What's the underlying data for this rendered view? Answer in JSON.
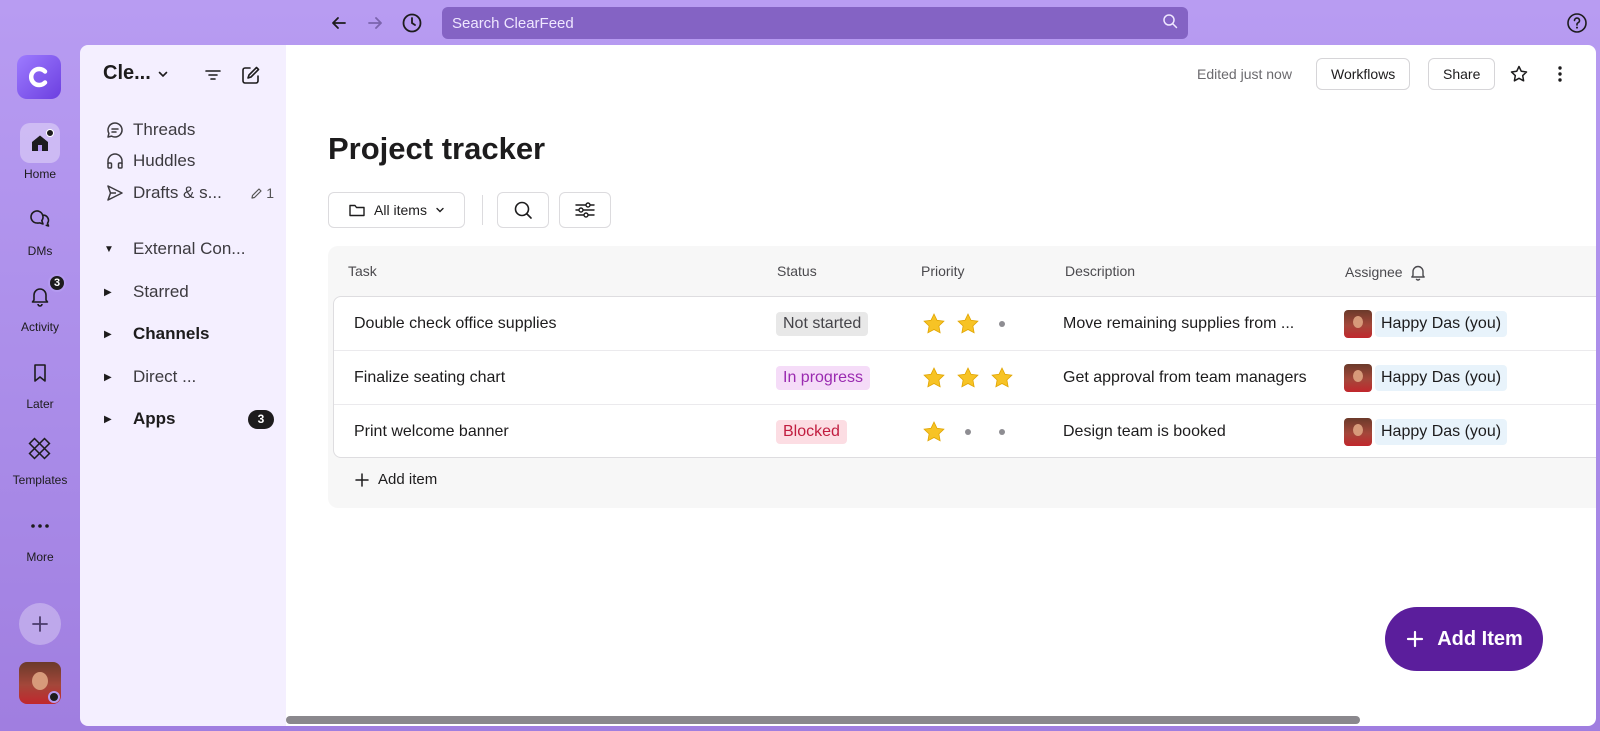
{
  "topbar": {
    "search_placeholder": "Search ClearFeed"
  },
  "rail": {
    "logo_letter": "C",
    "items": [
      {
        "label": "Home",
        "icon": "home-icon"
      },
      {
        "label": "DMs",
        "icon": "dms-icon"
      },
      {
        "label": "Activity",
        "icon": "bell-icon",
        "badge": "3"
      },
      {
        "label": "Later",
        "icon": "bookmark-icon"
      },
      {
        "label": "Templates",
        "icon": "templates-icon"
      },
      {
        "label": "More",
        "icon": "more-icon"
      }
    ]
  },
  "sidebar": {
    "workspace": "Cle...",
    "items": [
      {
        "label": "Threads",
        "icon": "threads-icon"
      },
      {
        "label": "Huddles",
        "icon": "headphones-icon"
      },
      {
        "label": "Drafts & s...",
        "icon": "send-icon",
        "count": "1"
      }
    ],
    "sections": [
      {
        "label": "External Con...",
        "expanded": true,
        "bold": false
      },
      {
        "label": "Starred",
        "expanded": false,
        "bold": false
      },
      {
        "label": "Channels",
        "expanded": false,
        "bold": true
      },
      {
        "label": "Direct ...",
        "expanded": false,
        "bold": false
      },
      {
        "label": "Apps",
        "expanded": false,
        "bold": true,
        "badge": "3"
      }
    ]
  },
  "header": {
    "edited": "Edited just now",
    "workflows_label": "Workflows",
    "share_label": "Share"
  },
  "page": {
    "title": "Project tracker",
    "filter_label": "All items"
  },
  "table": {
    "columns": [
      "Task",
      "Status",
      "Priority",
      "Description",
      "Assignee"
    ],
    "rows": [
      {
        "task": "Double check office supplies",
        "status": "Not started",
        "priority": 2,
        "description": "Move remaining supplies from ...",
        "assignee": "Happy Das (you)"
      },
      {
        "task": "Finalize seating chart",
        "status": "In progress",
        "priority": 3,
        "description": "Get approval from team managers",
        "assignee": "Happy Das (you)"
      },
      {
        "task": "Print welcome banner",
        "status": "Blocked",
        "priority": 1,
        "description": "Design team is booked",
        "assignee": "Happy Das (you)"
      }
    ],
    "add_item_label": "Add item"
  },
  "fab": {
    "label": "Add Item"
  },
  "colors": {
    "accent": "#5b1e9c",
    "status_not_started_bg": "#e8e8e8",
    "status_in_progress_bg": "#f5dcf8",
    "status_in_progress_fg": "#9a2ab0",
    "status_blocked_bg": "#fcdde3",
    "status_blocked_fg": "#c11d3f"
  }
}
